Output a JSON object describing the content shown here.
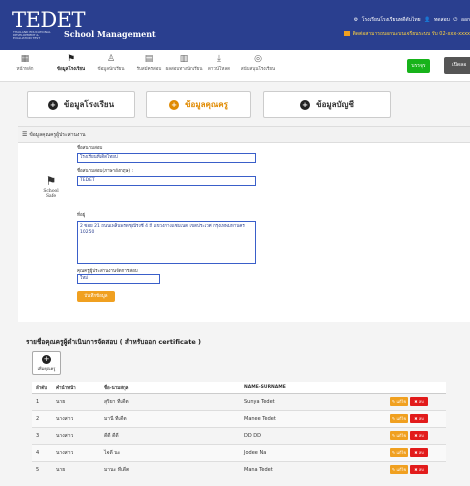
{
  "header": {
    "logo": "TEDET",
    "logo_sub": "THAILAND EDUCATIONAL DEVELOPMENT & EVALUATION TEST",
    "brand": "School Management",
    "links": [
      "โรงเรียนโรงเรียนทดีดับไทย",
      "ทดสอบ",
      "ออก"
    ],
    "note": "ติดต่อสามารถบอกนะบนเจรียนระบบ รับ 02-xxx-xxxx"
  },
  "nav": {
    "items": [
      {
        "label": "หน้าหลัก",
        "icon": "dashboard-icon"
      },
      {
        "label": "ข้อมูลโรงเรียน",
        "icon": "flag-icon"
      },
      {
        "label": "ข้อมูลนักเรียน",
        "icon": "users-icon"
      },
      {
        "label": "รับสมัครสอบ",
        "icon": "grid-icon"
      },
      {
        "label": "ผลสอบทางนักเรียน",
        "icon": "book-icon"
      },
      {
        "label": "ดาวน์โหลด",
        "icon": "download-icon"
      },
      {
        "label": "สนับสนุนโรงเรียน",
        "icon": "support-icon"
      }
    ],
    "green_button": "บรรจุร",
    "gray_button": "เปิดลอ"
  },
  "tabs": [
    {
      "label": "ข้อมูลโรงเรียน",
      "icon": "+"
    },
    {
      "label": "ข้อมูลคุณครู",
      "icon": "+"
    },
    {
      "label": "ข้อมูลบัญชี",
      "icon": "+"
    }
  ],
  "panel": {
    "title": "ข้อมูลคุณครูผู้ประสานงาน",
    "logo_text": "School Safe",
    "school_name_label": "ชื่อสนามสอบ",
    "school_name": "โรงเรียนที่เดิดไทยป",
    "school_name_en_label": "ชื่อสนามสอบ(ภาษาอังกฤษ) :",
    "school_name_en": "TEDET",
    "address_label": "ที่อยู่",
    "address": "2 ซอย 21 ถนนเพลินพรดชุณีรงชี 4 ถี แขวงกางแซบเนต เขตประเวศ กรุงเทพมหานคร 10250",
    "coordinator_label": "คุณครูผู้ประสานงานจัดการสอบ",
    "coordinator": "ใหม่",
    "save_button": "บันทึกข้อมูล"
  },
  "staff": {
    "title": "รายชื่อคุณครูผู้ดำเนินการจัดสอบ ( สำหรับออก certificate )",
    "add_button": "เพิ่มคุณครู",
    "columns": [
      "ลำดับ",
      "คำนำหน้า",
      "ชื่อ-นามสกุล",
      "NAME-SURNAME",
      ""
    ],
    "edit_label": "แก้ไข",
    "delete_label": "ลบ",
    "rows": [
      {
        "no": "1",
        "prefix": "นาย",
        "name": "สุริยา ทีเดีต",
        "name_en": "Sunya Tedet"
      },
      {
        "no": "2",
        "prefix": "นางสาว",
        "name": "มานี ทีเดีต",
        "name_en": "Manee Tedet"
      },
      {
        "no": "3",
        "prefix": "นางสาว",
        "name": "ดีดี ดีดี",
        "name_en": "DD DD"
      },
      {
        "no": "4",
        "prefix": "นางสาว",
        "name": "ไจดี นะ",
        "name_en": "Jodee Na"
      },
      {
        "no": "5",
        "prefix": "นาย",
        "name": "มานะ ทีเดีต",
        "name_en": "Mana Tedet"
      }
    ]
  }
}
